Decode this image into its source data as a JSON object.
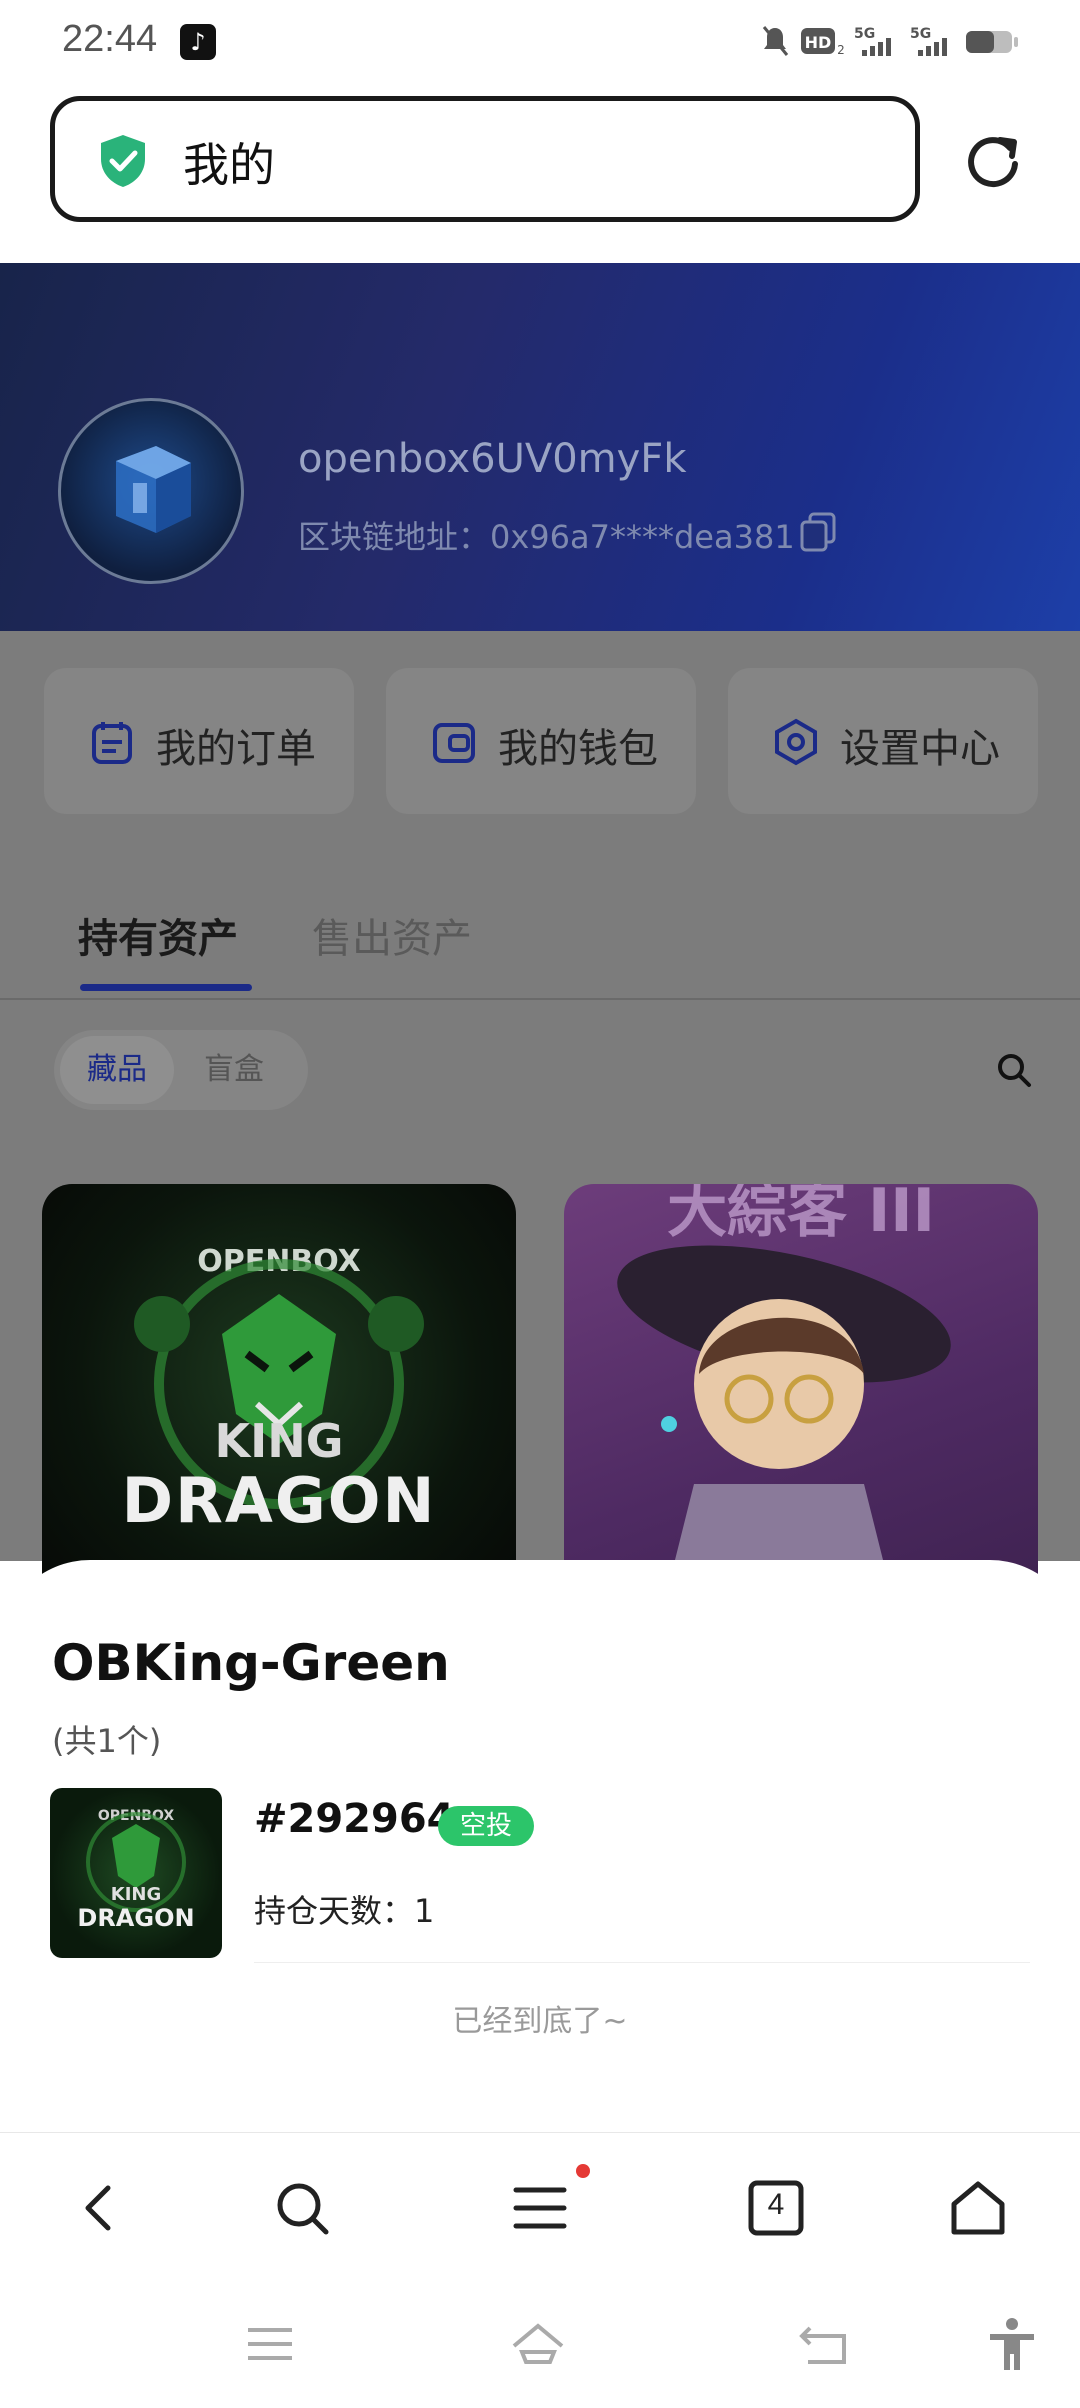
{
  "status_bar": {
    "time": "22:44",
    "icons": [
      "tiktok-icon",
      "mute-bell-icon",
      "hd-icon",
      "signal-5g-icon",
      "signal-5g-icon",
      "battery-icon"
    ]
  },
  "browser": {
    "url_text": "我的",
    "tabs_count": "4"
  },
  "profile": {
    "username": "openbox6UV0myFk",
    "address": "区块链地址：0x96a7****dea381"
  },
  "quick_links": [
    "我的订单",
    "我的钱包",
    "设置中心"
  ],
  "tabs": [
    "持有资产",
    "售出资产"
  ],
  "chips": [
    "藏品",
    "盲盒"
  ],
  "cards": [
    {
      "art_text_top": "OPENBOX",
      "art_text_mid": "KING",
      "art_text_bottom": "DRAGON"
    },
    {
      "art_text_top": "大綜客 III"
    }
  ],
  "sheet": {
    "title": "OBKing-Green",
    "count": "(共1个)",
    "item": {
      "id": "#292964",
      "badge": "空投",
      "hold_days": "持仓天数：1",
      "thumb_top": "OPENBOX",
      "thumb_mid": "KING",
      "thumb_bottom": "DRAGON"
    },
    "end_text": "已经到底了~"
  },
  "colors": {
    "accent": "#1b2a88",
    "badge": "#2cc56a",
    "notification_dot": "#e53935",
    "shield": "#2ab37a"
  }
}
